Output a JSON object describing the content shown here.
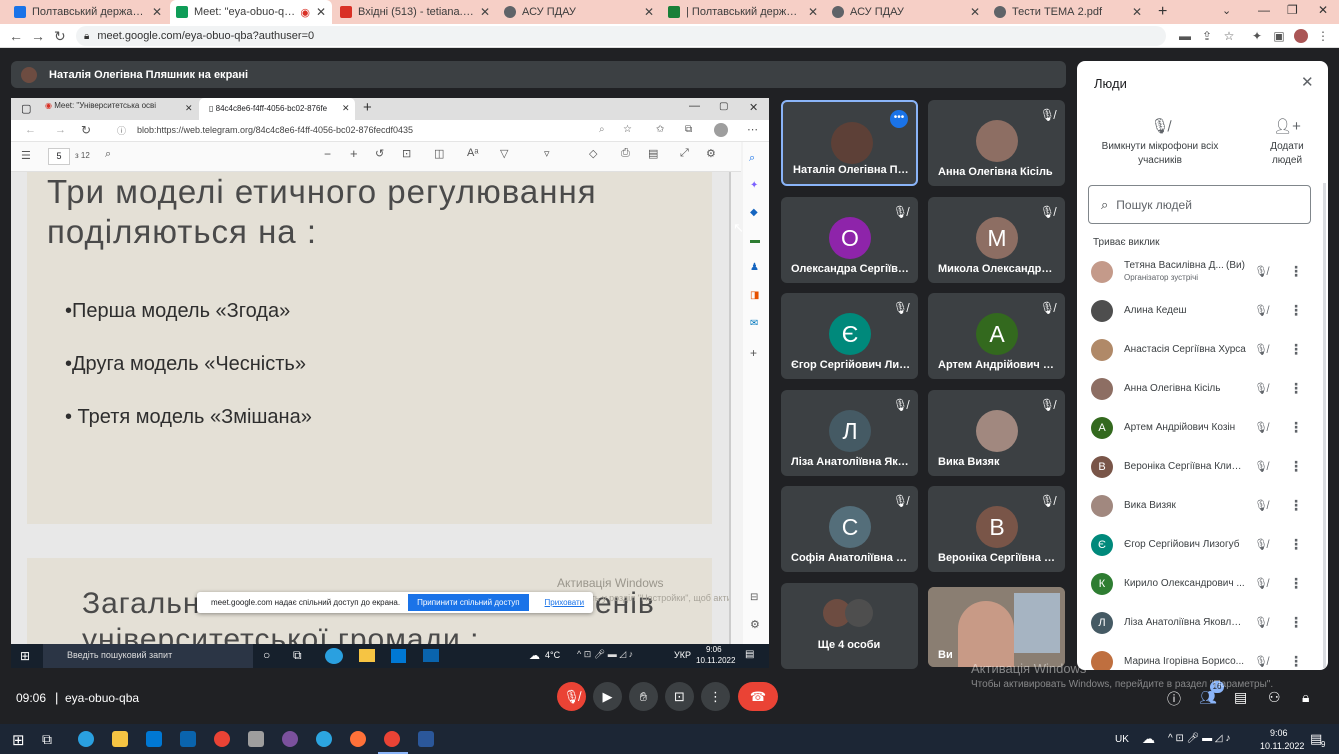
{
  "browser_tabs": [
    {
      "label": "Полтавський державний аграр",
      "color": "#1a73e8"
    },
    {
      "label": "Meet: \"eya-obuo-qba\"",
      "color": "#0f9d58"
    },
    {
      "label": "Вхідні (513) - tetiana.diadyk@p",
      "color": "#d93025"
    },
    {
      "label": "АСУ ПДАУ",
      "color": "#5f6368"
    },
    {
      "label": "| Полтавський державний агр",
      "color": "#188038"
    },
    {
      "label": "АСУ ПДАУ",
      "color": "#5f6368"
    },
    {
      "label": "Тести ТЕМА 2.pdf",
      "color": "#5f6368"
    }
  ],
  "url": "meet.google.com/eya-obuo-qba?authuser=0",
  "presenter_banner": "Наталія Олегівна Пляшник на екрані",
  "shared_screen": {
    "edge_tabs": [
      "Meet: \"Університетська осві",
      "84c4c8e6-f4ff-4056-bc02-876fe"
    ],
    "edge_url": "blob:https://web.telegram.org/84c4c8e6-f4ff-4056-bc02-876fecdf0435",
    "page_current": "5",
    "page_total": "з 12",
    "slide1_title_line1": "Три моделі етичного регулювання",
    "slide1_title_line2": "поділяються на :",
    "bullets": [
      "•Перша модель «Згода»",
      "•Друга модель «Чесність»",
      "• Третя модель «Змішана»"
    ],
    "slide2_title_a": "Загальн",
    "slide2_title_b": "енів",
    "slide2_title_line2": "університетської громади :",
    "activation_line1": "Активація Windows",
    "activation_line2": "Перейдіть у розділ \"Настройки\", щоб активувати",
    "share_toast_text": "meet.google.com надає спільний доступ до екрана.",
    "share_toast_stop": "Припинити спільний доступ",
    "share_toast_hide": "Приховати",
    "inner_search": "Введіть пошуковий запит",
    "inner_temp": "4°C",
    "inner_lang": "УКР",
    "inner_time": "9:06",
    "inner_date": "10.11.2022"
  },
  "tiles": [
    {
      "name": "Наталія Олегівна Пля...",
      "avatar": "",
      "color": "#5d4037"
    },
    {
      "name": "Анна Олегівна Кісіль",
      "avatar": "",
      "color": "#8d6e63"
    },
    {
      "name": "Олександра Сергіївна...",
      "avatar": "О",
      "color": "#8e24aa"
    },
    {
      "name": "Микола Олександров...",
      "avatar": "М",
      "color": "#8d6e63"
    },
    {
      "name": "Єгор Сергійович Лизо...",
      "avatar": "Є",
      "color": "#00897b"
    },
    {
      "name": "Артем Андрійович Ко...",
      "avatar": "А",
      "color": "#33691e"
    },
    {
      "name": "Ліза Анатоліївна Яков...",
      "avatar": "Л",
      "color": "#455a64"
    },
    {
      "name": "Вика Визяк",
      "avatar": "",
      "color": "#a1887f"
    },
    {
      "name": "Софія Анатоліївна Ма...",
      "avatar": "С",
      "color": "#546e7a"
    },
    {
      "name": "Вероніка Сергіївна Кл...",
      "avatar": "В",
      "color": "#795548"
    },
    {
      "name": "Ще 4 особи",
      "avatar": "",
      "color": "#6d4c41"
    },
    {
      "name": "Ви",
      "avatar": "",
      "color": "#5d4037"
    }
  ],
  "people_panel": {
    "title": "Люди",
    "mute_all": "Вимкнути мікрофони всіх учасників",
    "add_people": "Додати людей",
    "search_placeholder": "Пошук людей",
    "section": "Триває виклик",
    "host_label": "Організатор зустрічі",
    "you_label": "(Ви)",
    "participants": [
      {
        "name": "Тетяна Василівна Д...",
        "initial": "",
        "color": "#c49a8a"
      },
      {
        "name": "Алина Кедеш",
        "initial": "",
        "color": "#4e4e4e"
      },
      {
        "name": "Анастасія Сергіївна Хурса",
        "initial": "",
        "color": "#b08968"
      },
      {
        "name": "Анна Олегівна Кісіль",
        "initial": "",
        "color": "#8d6e63"
      },
      {
        "name": "Артем Андрійович Козін",
        "initial": "А",
        "color": "#33691e"
      },
      {
        "name": "Вероніка Сергіївна Клим...",
        "initial": "В",
        "color": "#795548"
      },
      {
        "name": "Вика Визяк",
        "initial": "",
        "color": "#a1887f"
      },
      {
        "name": "Єгор Сергійович Лизогуб",
        "initial": "Є",
        "color": "#00897b"
      },
      {
        "name": "Кирило Олександрович ...",
        "initial": "К",
        "color": "#2e7d32"
      },
      {
        "name": "Ліза Анатоліївна Яковлєва",
        "initial": "Л",
        "color": "#455a64"
      },
      {
        "name": "Марина Ігорівна Борисо...",
        "initial": "",
        "color": "#bf6f3f"
      }
    ]
  },
  "meeting_time": "09:06",
  "meeting_code": "eya-obuo-qba",
  "participants_badge": "16",
  "activation_line1": "Активація Windows",
  "activation_line2": "Чтобы активировать Windows, перейдите в раздел \"Параметры\".",
  "win_lang": "UK",
  "win_time": "9:06",
  "win_date": "10.11.2022",
  "win_notifications": "9"
}
